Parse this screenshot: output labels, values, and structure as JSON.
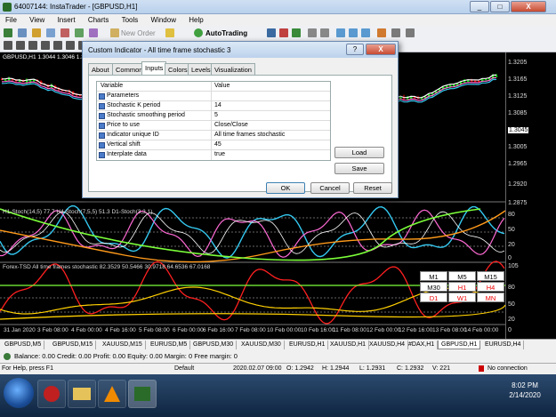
{
  "window": {
    "title": "64007144: InstaTrader - [GBPUSD,H1]",
    "min": "_",
    "max": "□",
    "close": "X"
  },
  "menu": [
    "File",
    "View",
    "Insert",
    "Charts",
    "Tools",
    "Window",
    "Help"
  ],
  "toolbar": {
    "new_order": "New Order",
    "autotrading": "AutoTrading"
  },
  "chart": {
    "symbol_label": "GBPUSD,H1  1.3044 1.3046 1.3044 1.3045",
    "price_labels": [
      "1.3205",
      "1.3165",
      "1.3125",
      "1.3085",
      "1.3045",
      "1.3005",
      "1.2965",
      "1.2920"
    ],
    "current_price": "1.3045",
    "indicator1_label": "H1-Stoch(14,5) 77.7  H4-Stoch(7,5,5) 51.3  D1-Stoch(3,3,1)",
    "indicator1_levels": [
      "1.2875",
      "80",
      "50",
      "20",
      "0"
    ],
    "indicator2_label": "Forex-TSD All time frames stochastic 82.3529 50.5466 30.9718 64.6536 67.0168",
    "indicator2_levels": [
      "105",
      "80",
      "50",
      "20",
      "0"
    ],
    "time_labels": [
      "31 Jan 2020",
      "3 Feb 08:00",
      "4 Feb 00:00",
      "4 Feb 16:00",
      "5 Feb 08:00",
      "6 Feb 00:00",
      "6 Feb 16:00",
      "7 Feb 08:00",
      "10 Feb 00:00",
      "10 Feb 16:00",
      "11 Feb 08:00",
      "12 Feb 00:00",
      "12 Feb 16:00",
      "13 Feb 08:00",
      "14 Feb 00:00"
    ],
    "tf_grid": [
      [
        "M1",
        "M5",
        "M15"
      ],
      [
        "M30",
        "H1",
        "H4"
      ],
      [
        "D1",
        "W1",
        "MN"
      ]
    ]
  },
  "dialog": {
    "title": "Custom Indicator - All time frame stochastic 3",
    "help": "?",
    "close": "X",
    "tabs": [
      "About",
      "Common",
      "Inputs",
      "Colors",
      "Levels",
      "Visualization"
    ],
    "active_tab": "Inputs",
    "col_variable": "Variable",
    "col_value": "Value",
    "rows": [
      {
        "name": "Parameters",
        "value": ""
      },
      {
        "name": "Stochastic K period",
        "value": "14"
      },
      {
        "name": "Stochastic smoothing period",
        "value": "5"
      },
      {
        "name": "Price to use",
        "value": "Close/Close"
      },
      {
        "name": "Indicator unique ID",
        "value": "All time frames stochastic"
      },
      {
        "name": "Vertical shift",
        "value": "45"
      },
      {
        "name": "Interplate data",
        "value": "true"
      }
    ],
    "load": "Load",
    "save": "Save",
    "ok": "OK",
    "cancel": "Cancel",
    "reset": "Reset"
  },
  "chart_tabs": [
    "GBPUSD,M5",
    "GBPUSD,M15",
    "XAUUSD,M15",
    "EURUSD,M5",
    "GBPUSD,M30",
    "XAUUSD,M30",
    "EURUSD,H1",
    "XAUUSD,H1",
    "XAUUSD,H4",
    "#DAX,H1",
    "GBPUSD,H1",
    "EURUSD,H4"
  ],
  "active_chart_tab": "GBPUSD,H1",
  "terminal": "Balance: 0.00  Credit: 0.00  Profit: 0.00  Equity: 0.00  Margin: 0  Free margin: 0",
  "status": {
    "help": "For Help, press F1",
    "profile": "Default",
    "time": "2020.02.07 09:00",
    "open": "O: 1.2942",
    "high": "H: 1.2944",
    "low": "L: 1.2931",
    "close": "C: 1.2932",
    "volume": "V: 221",
    "connection": "No connection"
  },
  "clock": {
    "time": "8:02 PM",
    "date": "2/14/2020"
  },
  "colors": {
    "bg": "#000000",
    "up": "#00ff00",
    "down": "#ff0000",
    "stoch_cyan": "#34c8f0",
    "stoch_pink": "#ff6ad5",
    "stoch_orange": "#ff9a1a",
    "stoch_white": "#ffffff",
    "stoch_lime": "#7cff3a",
    "stoch_red": "#ff2020",
    "stoch_yellow": "#ffd000"
  }
}
